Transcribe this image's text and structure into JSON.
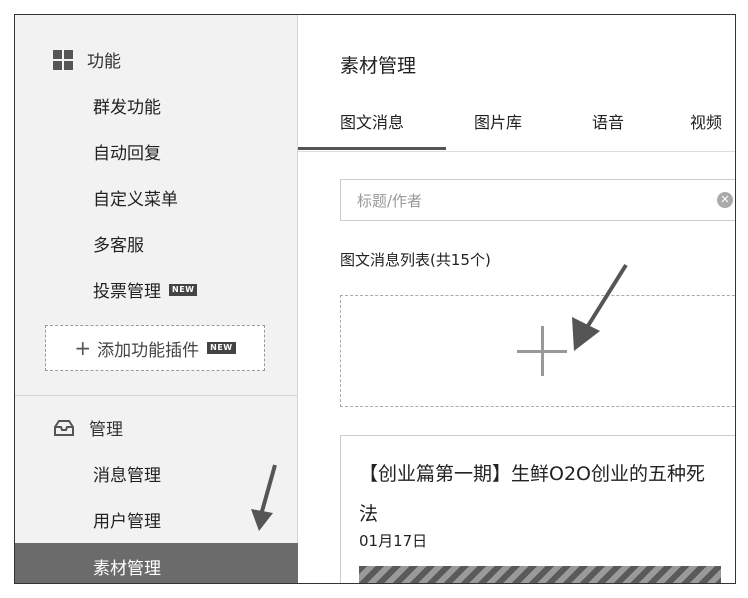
{
  "sidebar": {
    "section_function": {
      "label": "功能",
      "items": [
        {
          "label": "群发功能"
        },
        {
          "label": "自动回复"
        },
        {
          "label": "自定义菜单"
        },
        {
          "label": "多客服"
        },
        {
          "label": "投票管理",
          "badge": "NEW"
        }
      ],
      "add_plugin": {
        "label": "添加功能插件",
        "badge": "NEW"
      }
    },
    "section_manage": {
      "label": "管理",
      "items": [
        {
          "label": "消息管理"
        },
        {
          "label": "用户管理"
        },
        {
          "label": "素材管理",
          "active": true
        }
      ]
    }
  },
  "main": {
    "title": "素材管理",
    "tabs": [
      {
        "label": "图文消息",
        "active": true
      },
      {
        "label": "图片库"
      },
      {
        "label": "语音"
      },
      {
        "label": "视频"
      }
    ],
    "search": {
      "placeholder": "标题/作者",
      "value": ""
    },
    "list_title": "图文消息列表(共15个)",
    "article": {
      "title": "【创业篇第一期】生鲜O2O创业的五种死法",
      "date": "01月17日"
    }
  },
  "colors": {
    "sidebar_bg": "#f2f2f2",
    "active_bg": "#6b6b6b",
    "badge_bg": "#444444"
  }
}
